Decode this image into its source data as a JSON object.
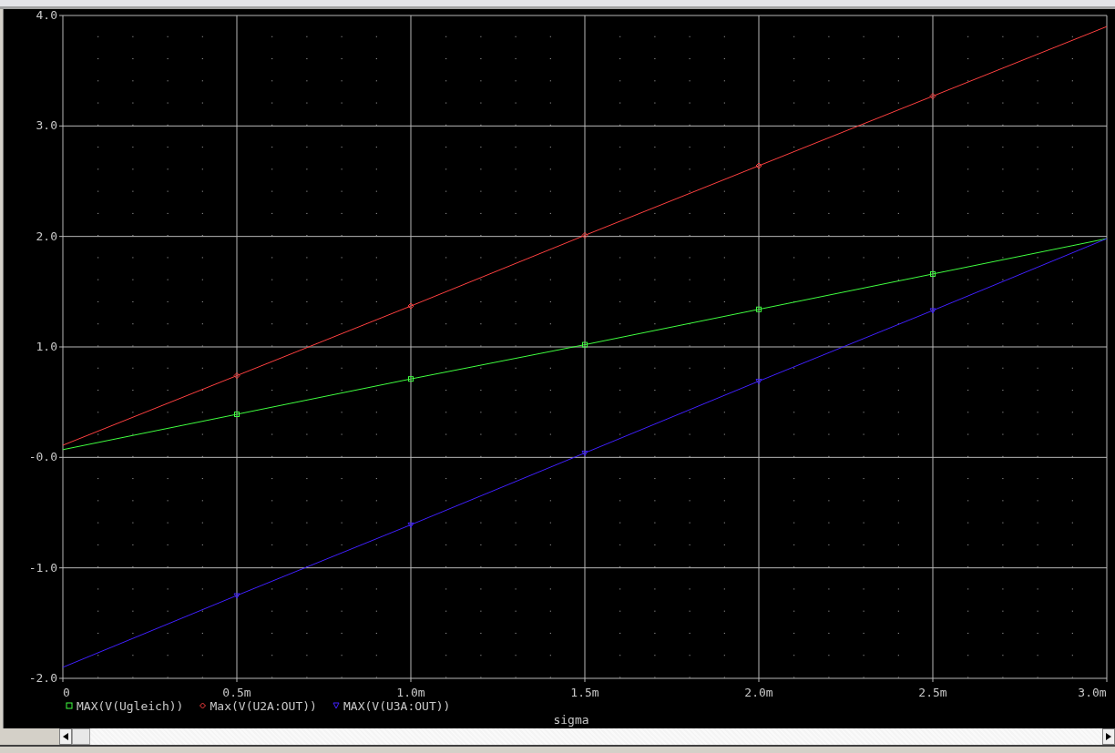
{
  "chart_data": {
    "type": "line",
    "xlabel": "sigma",
    "x": [
      0,
      0.5,
      1.0,
      1.5,
      2.0,
      2.5,
      3.0
    ],
    "xlim": [
      0,
      3.0
    ],
    "ylim": [
      -2,
      4
    ],
    "grid": true,
    "legend": "bottom",
    "xticks": [
      {
        "value": 0,
        "label": "0"
      },
      {
        "value": 0.5,
        "label": "0.5m"
      },
      {
        "value": 1.0,
        "label": "1.0m"
      },
      {
        "value": 1.5,
        "label": "1.5m"
      },
      {
        "value": 2.0,
        "label": "2.0m"
      },
      {
        "value": 2.5,
        "label": "2.5m"
      },
      {
        "value": 3.0,
        "label": "3.0m"
      }
    ],
    "yticks": [
      {
        "value": 4,
        "label": "4.0"
      },
      {
        "value": 3,
        "label": "3.0"
      },
      {
        "value": 2,
        "label": "2.0"
      },
      {
        "value": 1,
        "label": "1.0"
      },
      {
        "value": 0,
        "label": "-0.0"
      },
      {
        "value": -1,
        "label": "-1.0"
      },
      {
        "value": -2,
        "label": "-2.0"
      }
    ],
    "series": [
      {
        "name": "MAX(V(Ugleich))",
        "color": "#40ff40",
        "values": [
          0.07,
          0.39,
          0.71,
          1.02,
          1.34,
          1.66,
          1.98
        ]
      },
      {
        "name": "Max(V(U2A:OUT))",
        "color": "#ff4040",
        "values": [
          0.11,
          0.74,
          1.37,
          2.01,
          2.64,
          3.27,
          3.9
        ]
      },
      {
        "name": "MAX(V(U3A:OUT))",
        "color": "#4020ff",
        "values": [
          -1.9,
          -1.25,
          -0.61,
          0.04,
          0.69,
          1.33,
          1.98
        ]
      }
    ]
  }
}
